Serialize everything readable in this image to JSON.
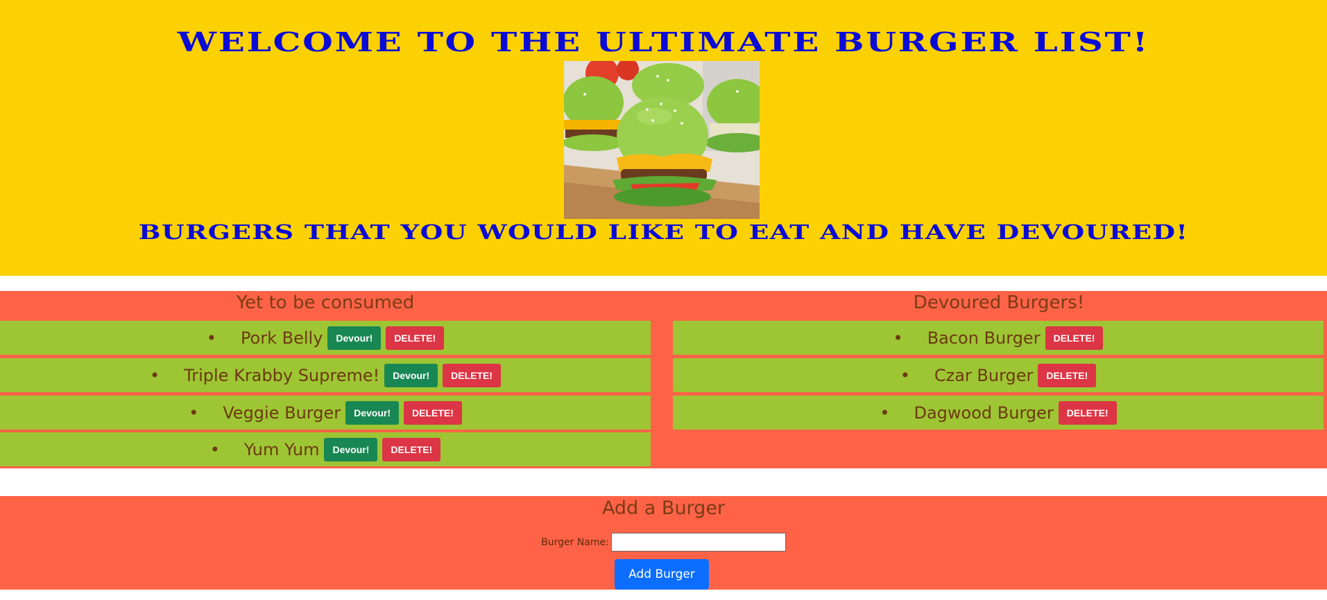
{
  "header": {
    "title": "WELCOME TO THE ULTIMATE BURGER LIST!",
    "subtitle": "BURGERS THAT YOU WOULD LIKE TO EAT AND HAVE DEVOURED!"
  },
  "columns": {
    "uneaten_title": "Yet to be consumed",
    "devoured_title": "Devoured Burgers!"
  },
  "uneaten": [
    {
      "name": "Pork Belly"
    },
    {
      "name": "Triple Krabby Supreme!"
    },
    {
      "name": "Veggie Burger"
    },
    {
      "name": "Yum Yum"
    }
  ],
  "devoured": [
    {
      "name": "Bacon Burger"
    },
    {
      "name": "Czar Burger"
    },
    {
      "name": "Dagwood Burger"
    }
  ],
  "buttons": {
    "devour_label": "Devour!",
    "delete_label": "DELETE!"
  },
  "add_form": {
    "title": "Add a Burger",
    "label": "Burger Name:",
    "value": "",
    "submit_label": "Add Burger"
  },
  "colors": {
    "header_bg": "#fbd104",
    "section_bg": "#fe6347",
    "row_bg": "#9ec533",
    "title_text": "#0b0bd6",
    "devour_button": "#198754",
    "delete_button": "#dc3545",
    "add_button": "#0d6efd"
  }
}
